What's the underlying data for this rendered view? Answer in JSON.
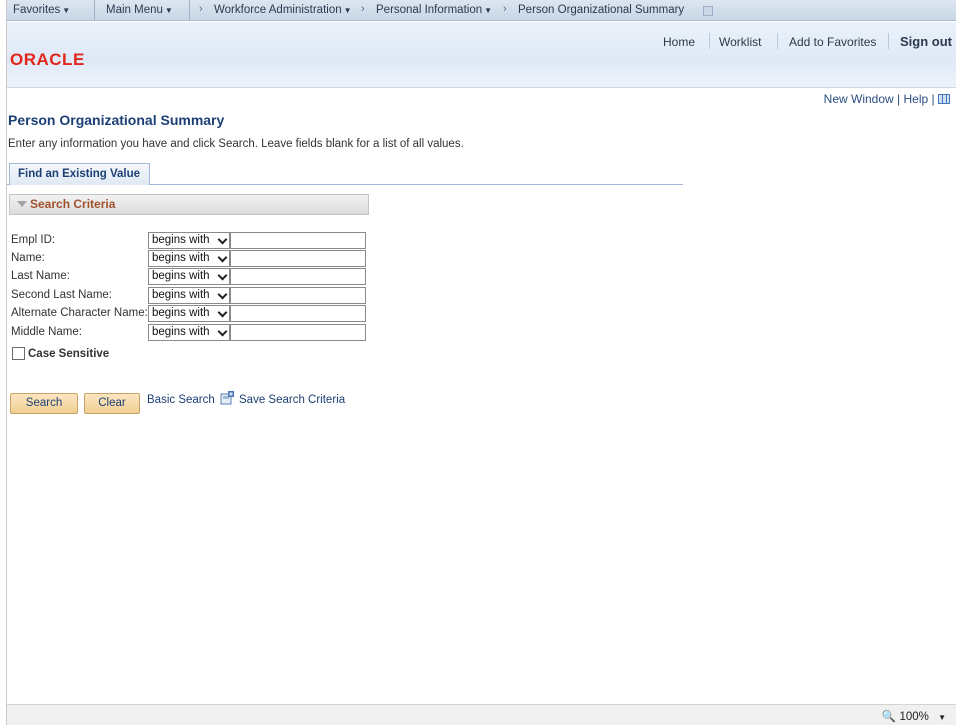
{
  "nav": {
    "favorites": "Favorites",
    "main_menu": "Main Menu",
    "workforce_admin": "Workforce Administration",
    "personal_info": "Personal Information",
    "current_page": "Person Organizational Summary"
  },
  "header": {
    "logo": "ORACLE",
    "home": "Home",
    "worklist": "Worklist",
    "add_to_favorites": "Add to Favorites",
    "sign_out": "Sign out"
  },
  "util": {
    "new_window": "New Window",
    "separator": "|",
    "help": "Help"
  },
  "page": {
    "title": "Person Organizational Summary",
    "instructions": "Enter any information you have and click Search. Leave fields blank for a list of all values."
  },
  "tab": {
    "label": "Find an Existing Value"
  },
  "section": {
    "label": "Search Criteria"
  },
  "fields": [
    {
      "label": "Empl ID:",
      "operator": "begins with",
      "value": ""
    },
    {
      "label": "Name:",
      "operator": "begins with",
      "value": ""
    },
    {
      "label": "Last Name:",
      "operator": "begins with",
      "value": ""
    },
    {
      "label": "Second Last Name:",
      "operator": "begins with",
      "value": ""
    },
    {
      "label": "Alternate Character Name:",
      "operator": "begins with",
      "value": ""
    },
    {
      "label": "Middle Name:",
      "operator": "begins with",
      "value": ""
    }
  ],
  "case_sensitive": {
    "label": "Case Sensitive",
    "checked": false
  },
  "actions": {
    "search": "Search",
    "clear": "Clear",
    "basic_search": "Basic Search",
    "save_search": "Save Search Criteria"
  },
  "status": {
    "zoom": "100%"
  },
  "colors": {
    "oracle_red": "#e2261b",
    "title_blue": "#1c3f75",
    "section_brown": "#a0522d",
    "button_orange": "#f2cf92"
  }
}
